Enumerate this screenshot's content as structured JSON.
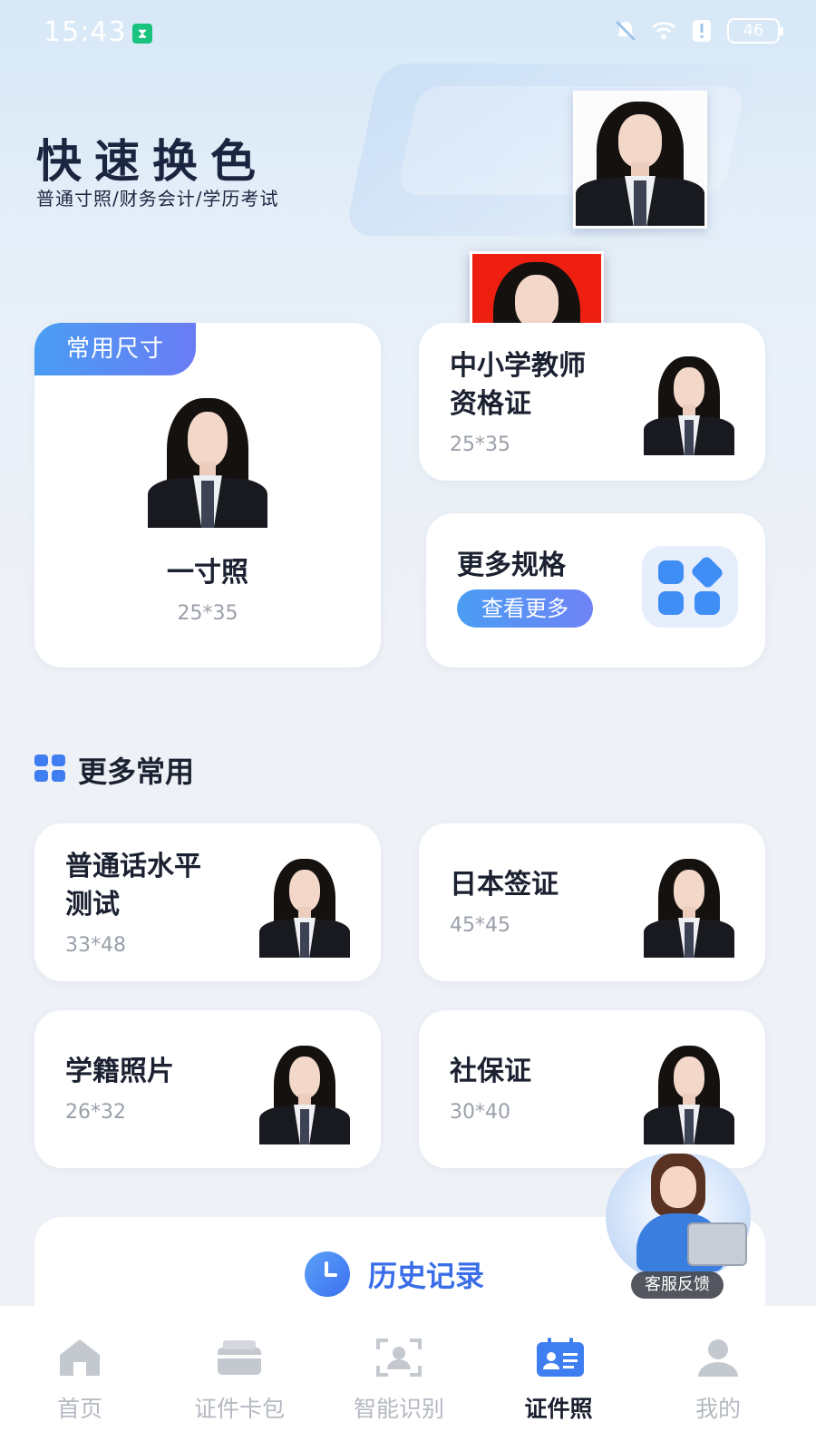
{
  "status_bar": {
    "time": "15:43",
    "battery": "46"
  },
  "hero": {
    "title": "快速换色",
    "subtitle": "普通寸照/财务会计/学历考试"
  },
  "featured": {
    "badge": "常用尺寸",
    "main": {
      "title": "一寸照",
      "size": "25*35"
    },
    "teacher": {
      "title_line1": "中小学教师",
      "title_line2": "资格证",
      "size": "25*35"
    },
    "more": {
      "title": "更多规格",
      "button": "查看更多"
    }
  },
  "section": {
    "title": "更多常用"
  },
  "common_items": [
    {
      "title_line1": "普通话水平",
      "title_line2": "测试",
      "size": "33*48"
    },
    {
      "title_line1": "日本签证",
      "title_line2": "",
      "size": "45*45"
    },
    {
      "title_line1": "学籍照片",
      "title_line2": "",
      "size": "26*32"
    },
    {
      "title_line1": "社保证",
      "title_line2": "",
      "size": "30*40"
    }
  ],
  "history": {
    "label": "历史记录"
  },
  "service": {
    "label": "客服反馈"
  },
  "tabbar": {
    "tabs": [
      {
        "label": "首页",
        "icon": "home-icon"
      },
      {
        "label": "证件卡包",
        "icon": "card-wallet-icon"
      },
      {
        "label": "智能识别",
        "icon": "scan-person-icon"
      },
      {
        "label": "证件照",
        "icon": "id-photo-icon"
      },
      {
        "label": "我的",
        "icon": "profile-icon"
      }
    ],
    "active": "证件照"
  },
  "colors": {
    "accent": "#3f7ef0",
    "badge_gradient_start": "#4a9df3",
    "red_background": "#ee1f10"
  }
}
